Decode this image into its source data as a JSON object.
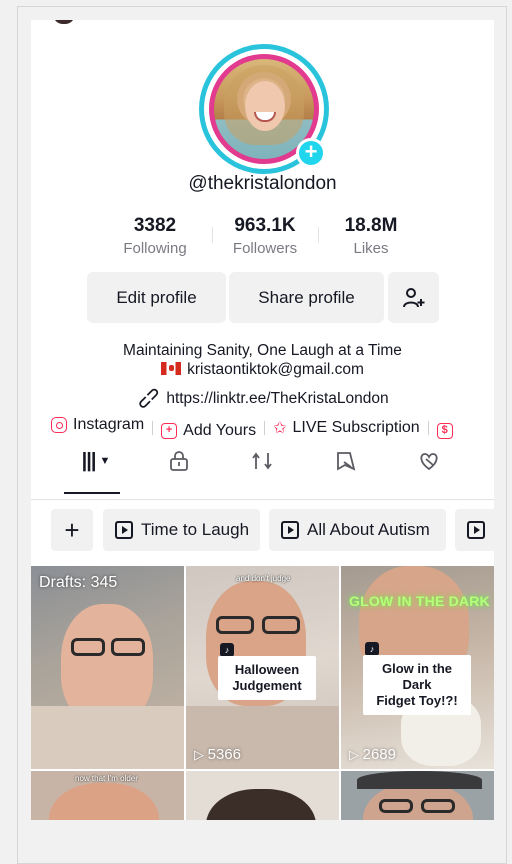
{
  "profile": {
    "username": "@thekristalondon",
    "stats": [
      {
        "value": "3382",
        "label": "Following"
      },
      {
        "value": "963.1K",
        "label": "Followers"
      },
      {
        "value": "18.8M",
        "label": "Likes"
      }
    ]
  },
  "actions": {
    "edit": "Edit profile",
    "share": "Share profile"
  },
  "bio": {
    "line1": "Maintaining Sanity, One Laugh at a Time",
    "email": "kristaontiktok@gmail.com",
    "link": "https://linktr.ee/TheKristaLondon"
  },
  "chips": [
    {
      "label": "Instagram",
      "icon": "instagram-icon"
    },
    {
      "label": "Add Yours",
      "icon": "add-yours-icon"
    },
    {
      "label": "LIVE Subscription",
      "icon": "live-subscription-icon"
    }
  ],
  "playlists": {
    "items": [
      "Time to Laugh",
      "All About Autism"
    ]
  },
  "videos": [
    {
      "overlay": "Drafts: 345"
    },
    {
      "title_line1": "Halloween",
      "title_line2": "Judgement",
      "top_text": "and don't judge",
      "views": "5366"
    },
    {
      "banner": "GLOW IN THE DARK",
      "title_line1": "Glow in the Dark",
      "title_line2": "Fidget Toy!?!",
      "views": "2689"
    },
    {
      "top_text": "now that I'm older"
    }
  ],
  "colors": {
    "accent": "#fe2c55",
    "ring": "#29c4dc",
    "ring_inner": "#e23a8e",
    "badge": "#20d5ec"
  }
}
